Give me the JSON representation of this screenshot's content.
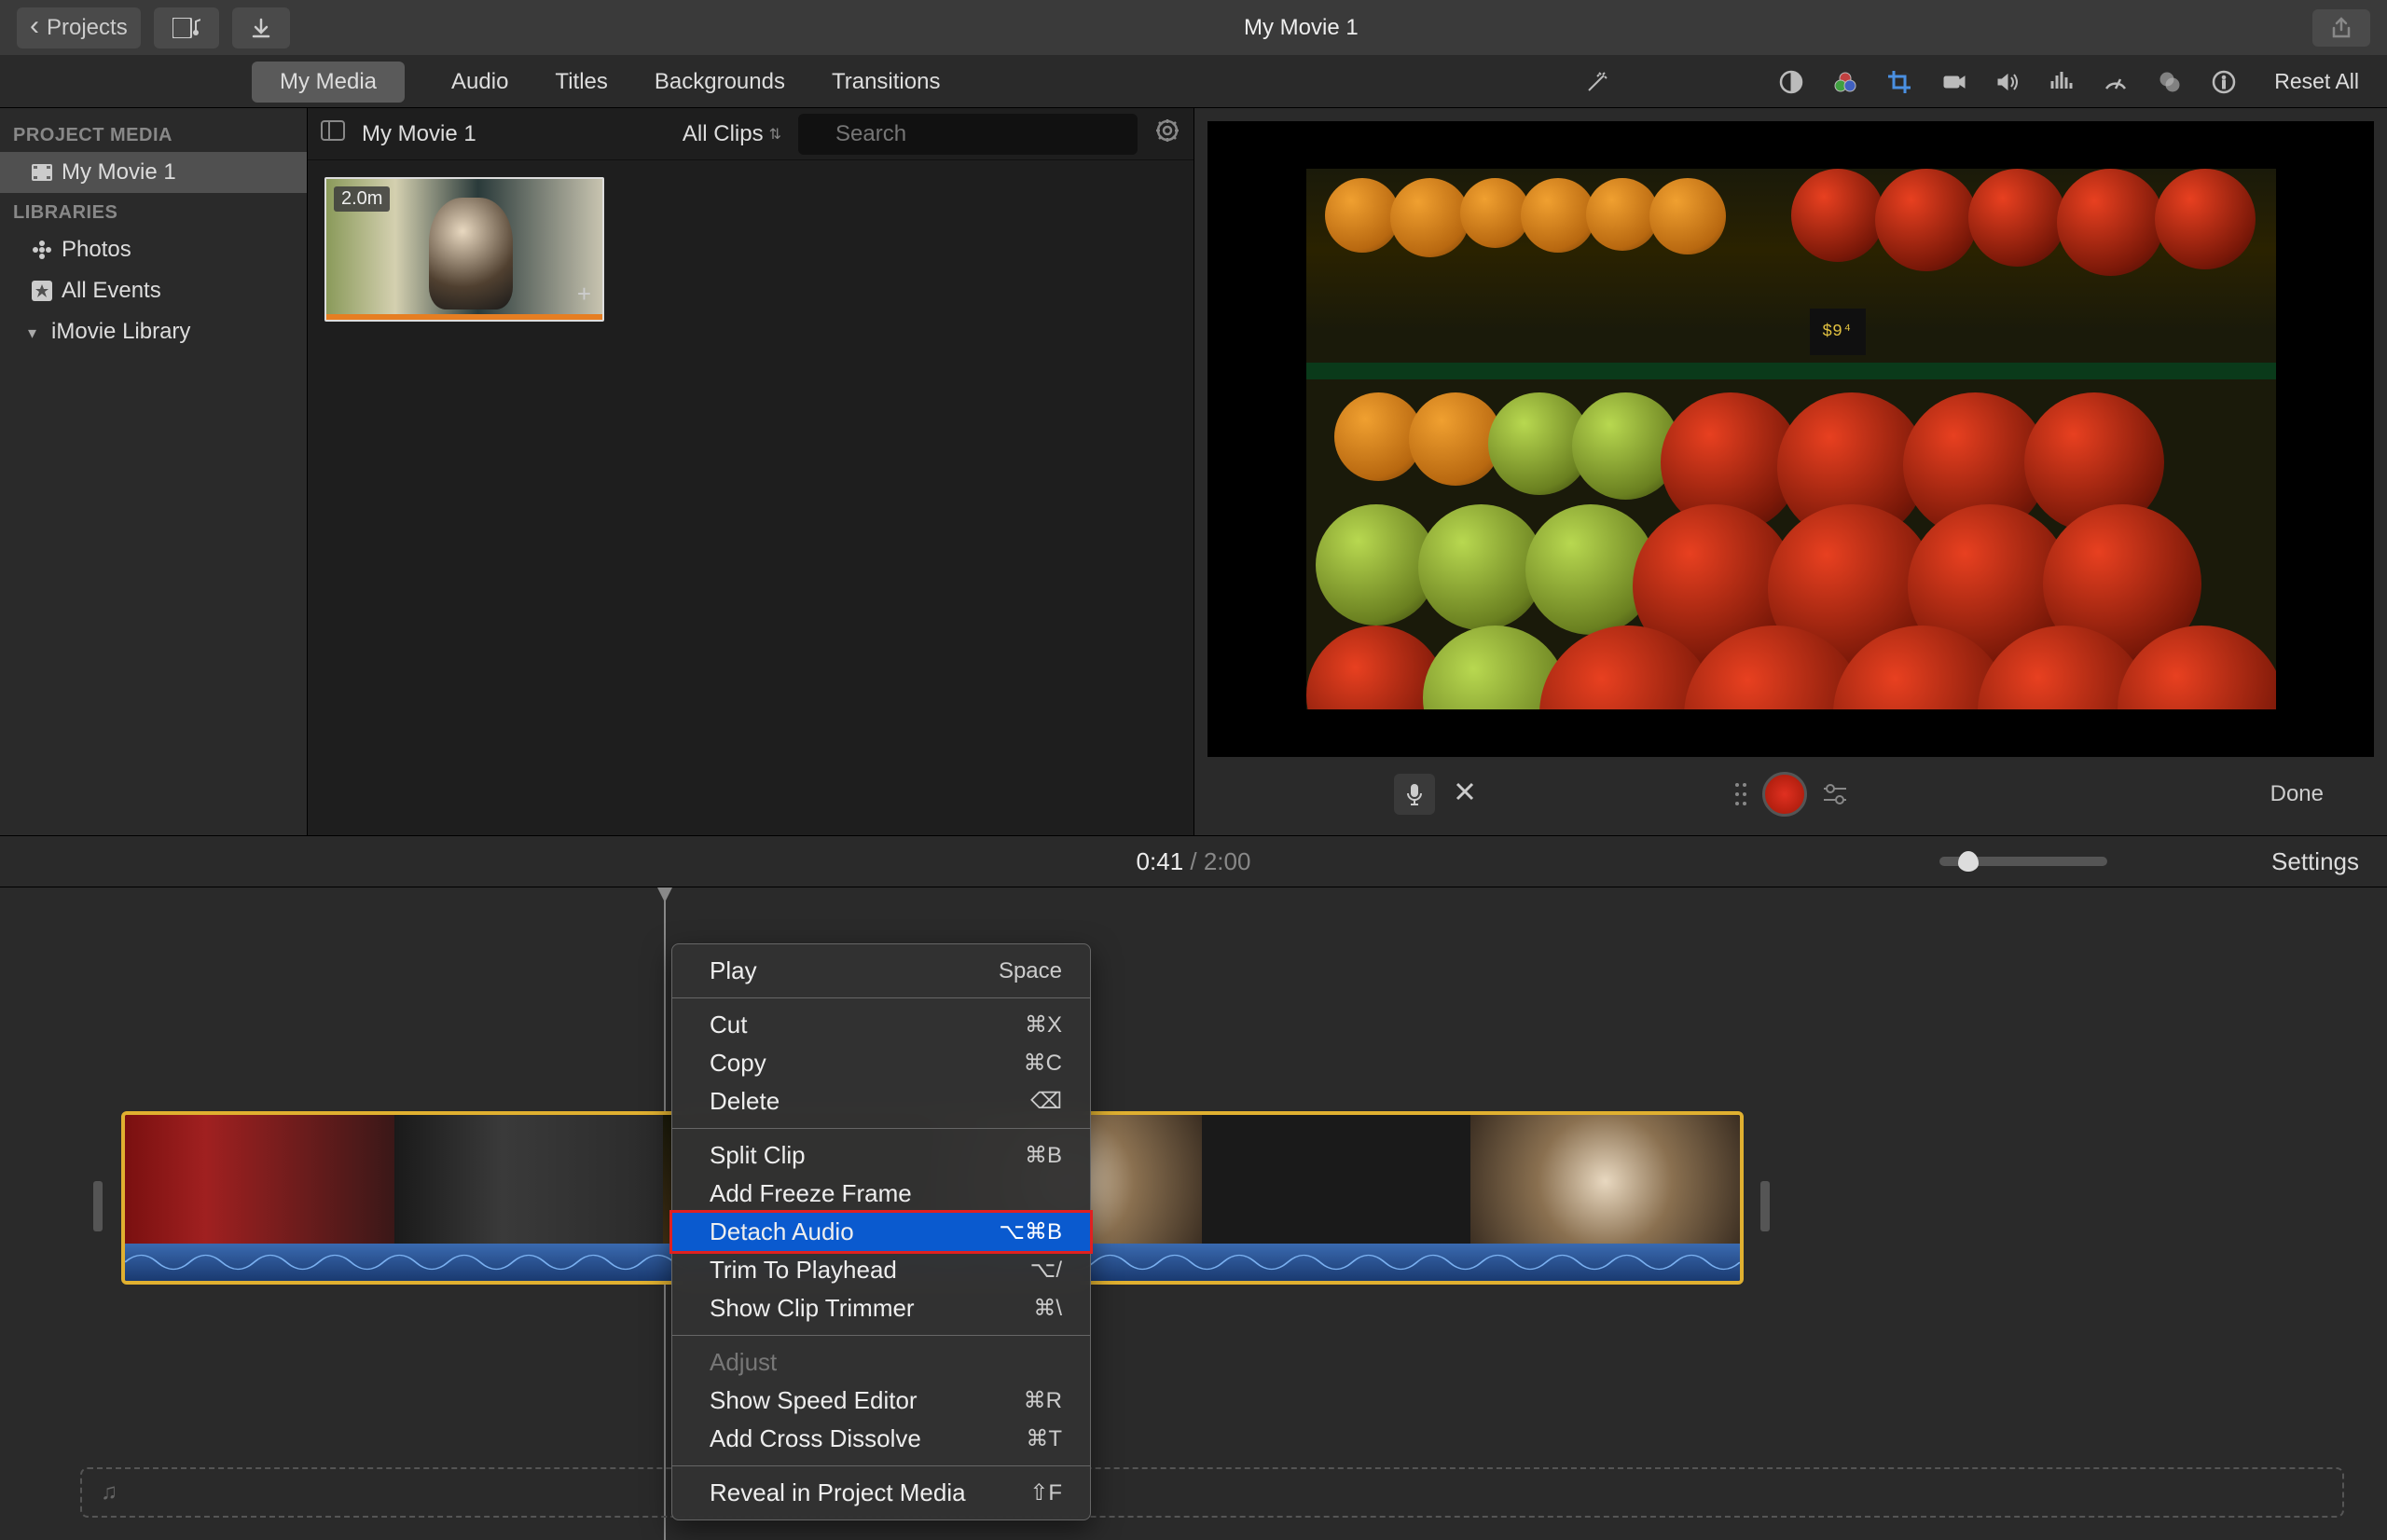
{
  "topBar": {
    "backLabel": "Projects",
    "title": "My Movie 1"
  },
  "mediaTabs": [
    "My Media",
    "Audio",
    "Titles",
    "Backgrounds",
    "Transitions"
  ],
  "activeMediaTab": 0,
  "adjustToolbar": {
    "resetAll": "Reset All",
    "icons": [
      "wand",
      "balance",
      "color-wheel",
      "crop",
      "camera",
      "volume",
      "eq",
      "speed",
      "overlay",
      "info"
    ]
  },
  "sidebar": {
    "sections": [
      {
        "header": "PROJECT MEDIA",
        "items": [
          {
            "label": "My Movie 1",
            "icon": "clip",
            "selected": true
          }
        ]
      },
      {
        "header": "LIBRARIES",
        "items": [
          {
            "label": "Photos",
            "icon": "flower"
          },
          {
            "label": "All Events",
            "icon": "star"
          },
          {
            "label": "iMovie Library",
            "icon": "disclosure"
          }
        ]
      }
    ]
  },
  "browser": {
    "title": "My Movie 1",
    "filter": "All Clips",
    "searchPlaceholder": "Search",
    "clipDuration": "2.0m"
  },
  "viewer": {
    "doneLabel": "Done",
    "priceTag": "$9⁴"
  },
  "timeline": {
    "currentTime": "0:41",
    "totalTime": "2:00",
    "settingsLabel": "Settings"
  },
  "contextMenu": {
    "groups": [
      [
        {
          "label": "Play",
          "shortcut": "Space"
        }
      ],
      [
        {
          "label": "Cut",
          "shortcut": "⌘X"
        },
        {
          "label": "Copy",
          "shortcut": "⌘C"
        },
        {
          "label": "Delete",
          "shortcut": "⌫"
        }
      ],
      [
        {
          "label": "Split Clip",
          "shortcut": "⌘B"
        },
        {
          "label": "Add Freeze Frame",
          "shortcut": ""
        },
        {
          "label": "Detach Audio",
          "shortcut": "⌥⌘B",
          "highlighted": true
        },
        {
          "label": "Trim To Playhead",
          "shortcut": "⌥/"
        },
        {
          "label": "Show Clip Trimmer",
          "shortcut": "⌘\\"
        }
      ],
      [
        {
          "label": "Adjust",
          "shortcut": "",
          "disabled": true
        },
        {
          "label": "Show Speed Editor",
          "shortcut": "⌘R"
        },
        {
          "label": "Add Cross Dissolve",
          "shortcut": "⌘T"
        }
      ],
      [
        {
          "label": "Reveal in Project Media",
          "shortcut": "⇧F"
        }
      ]
    ]
  }
}
